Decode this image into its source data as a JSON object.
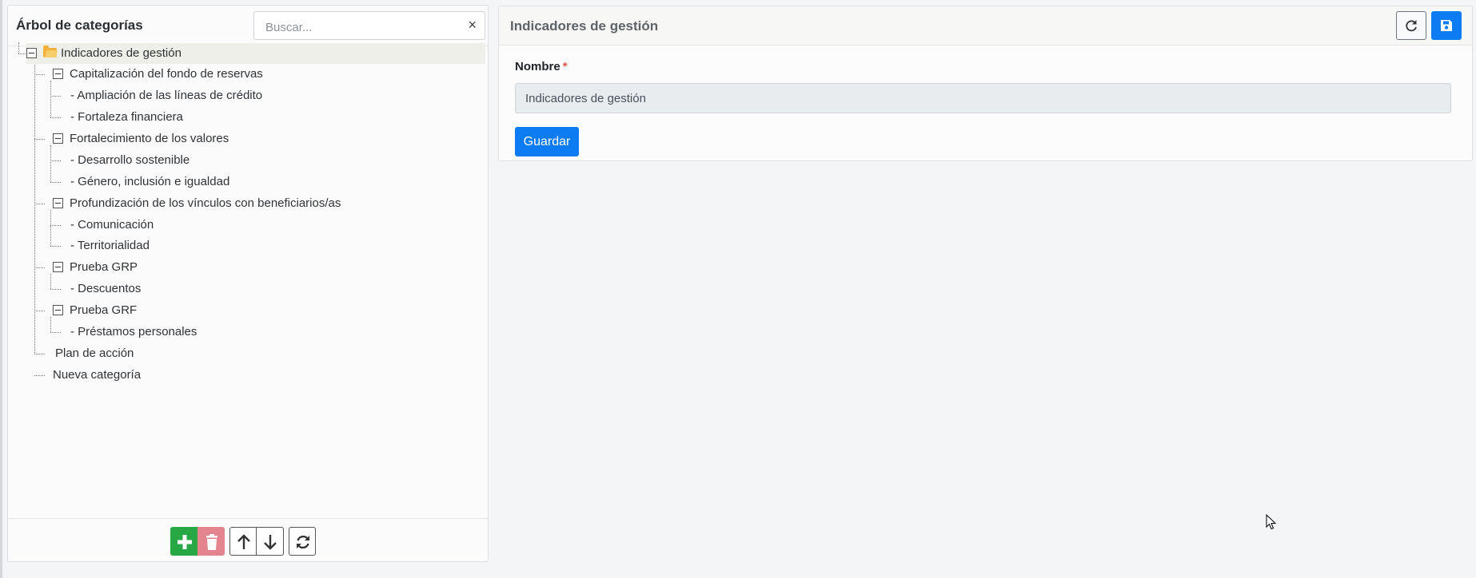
{
  "tree_panel": {
    "title": "Árbol de categorías",
    "search_placeholder": "Buscar...",
    "clear_glyph": "×",
    "items": [
      {
        "label": "Indicadores de gestión"
      },
      {
        "label": "Capitalización del fondo de reservas"
      },
      {
        "label": "- Ampliación de las líneas de crédito"
      },
      {
        "label": "- Fortaleza financiera"
      },
      {
        "label": "Fortalecimiento de los valores"
      },
      {
        "label": "- Desarrollo sostenible"
      },
      {
        "label": "- Género, inclusión e igualdad"
      },
      {
        "label": "Profundización de los vínculos con beneficiarios/as"
      },
      {
        "label": "- Comunicación"
      },
      {
        "label": "- Territorialidad"
      },
      {
        "label": "Prueba GRP"
      },
      {
        "label": "- Descuentos"
      },
      {
        "label": "Prueba GRF"
      },
      {
        "label": "- Préstamos personales"
      },
      {
        "label": "Plan de acción"
      },
      {
        "label": "Nueva categoría"
      }
    ],
    "toolbar_icons": [
      "plus-icon",
      "trash-icon",
      "arrow-up-icon",
      "arrow-down-icon",
      "refresh-icon"
    ]
  },
  "form_panel": {
    "title": "Indicadores de gestión",
    "name_label": "Nombre",
    "required_mark": "*",
    "name_value": "Indicadores de gestión",
    "save_label": "Guardar",
    "header_icons": [
      "reload-icon",
      "save-icon"
    ]
  },
  "colors": {
    "primary": "#0d7cf2",
    "success": "#28a745",
    "danger_light": "#e4848f",
    "folder": "#f0b23a",
    "required": "#e0574f"
  }
}
